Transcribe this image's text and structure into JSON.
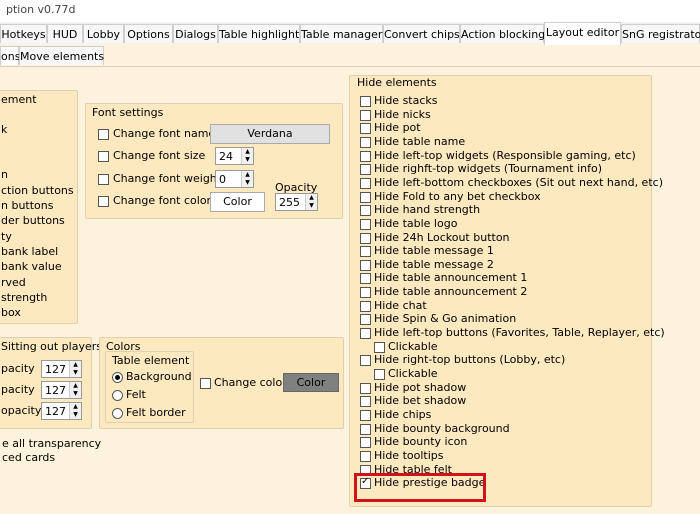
{
  "window": {
    "title": "ption v0.77d"
  },
  "tabs": [
    "Hotkeys",
    "HUD",
    "Lobby",
    "Options",
    "Dialogs",
    "Table highlight",
    "Table manager",
    "Convert chips",
    "Action blocking",
    "Layout editor",
    "SnG registrator"
  ],
  "subtabs": [
    "ons",
    "Move elements"
  ],
  "element_group": {
    "label": "ement",
    "items": [
      "k",
      "",
      "n",
      "ction buttons",
      "n buttons",
      "der buttons",
      "ty",
      "bank label",
      "bank value",
      "rved",
      "strength",
      "box"
    ]
  },
  "font_settings": {
    "label": "Font settings",
    "change_font_name": "Change font name",
    "font_name": "Verdana",
    "change_font_size": "Change font size",
    "font_size": "24",
    "change_font_weight": "Change font weight",
    "font_weight": "0",
    "change_font_color": "Change font color",
    "color_button": "Color",
    "opacity_label": "Opacity",
    "opacity_value": "255"
  },
  "sitting_out": {
    "label": "Sitting out players",
    "rows": [
      {
        "label": "pacity",
        "value": "127"
      },
      {
        "label": "pacity",
        "value": "127"
      },
      {
        "label": "opacity",
        "value": "127"
      }
    ]
  },
  "colors": {
    "label": "Colors",
    "table_element_label": "Table element",
    "options": [
      "Background",
      "Felt",
      "Felt border"
    ],
    "selected": "Background",
    "change_color": "Change color",
    "color_button": "Color"
  },
  "bottom_left": [
    "e all transparency",
    "ced cards"
  ],
  "hide_elements": {
    "label": "Hide elements",
    "items": [
      {
        "label": "Hide stacks",
        "checked": false
      },
      {
        "label": "Hide nicks",
        "checked": false
      },
      {
        "label": "Hide pot",
        "checked": false
      },
      {
        "label": "Hide table name",
        "checked": false
      },
      {
        "label": "Hide left-top widgets (Responsible gaming, etc)",
        "checked": false
      },
      {
        "label": "Hide righft-top widgets (Tournament info)",
        "checked": false
      },
      {
        "label": "Hide left-bottom checkboxes (Sit out next hand, etc)",
        "checked": false
      },
      {
        "label": "Hide Fold to any bet checkbox",
        "checked": false
      },
      {
        "label": "Hide hand strength",
        "checked": false
      },
      {
        "label": "Hide table logo",
        "checked": false
      },
      {
        "label": "Hide 24h Lockout button",
        "checked": false
      },
      {
        "label": "Hide table message 1",
        "checked": false
      },
      {
        "label": "Hide table message 2",
        "checked": false
      },
      {
        "label": "Hide table announcement 1",
        "checked": false
      },
      {
        "label": "Hide table announcement 2",
        "checked": false
      },
      {
        "label": "Hide chat",
        "checked": false
      },
      {
        "label": "Hide Spin & Go animation",
        "checked": false
      },
      {
        "label": "Hide left-top buttons (Favorites, Table, Replayer, etc)",
        "checked": false
      },
      {
        "label": "Clickable",
        "checked": false,
        "indent": true
      },
      {
        "label": "Hide right-top buttons (Lobby, etc)",
        "checked": false
      },
      {
        "label": "Clickable",
        "checked": false,
        "indent": true
      },
      {
        "label": "Hide pot shadow",
        "checked": false
      },
      {
        "label": "Hide bet shadow",
        "checked": false
      },
      {
        "label": "Hide chips",
        "checked": false
      },
      {
        "label": "Hide bounty background",
        "checked": false
      },
      {
        "label": "Hide bounty icon",
        "checked": false
      },
      {
        "label": "Hide tooltips",
        "checked": false
      },
      {
        "label": "Hide table felt",
        "checked": false
      },
      {
        "label": "Hide prestige badge",
        "checked": true
      }
    ]
  },
  "highlight_color": "#d0131b"
}
